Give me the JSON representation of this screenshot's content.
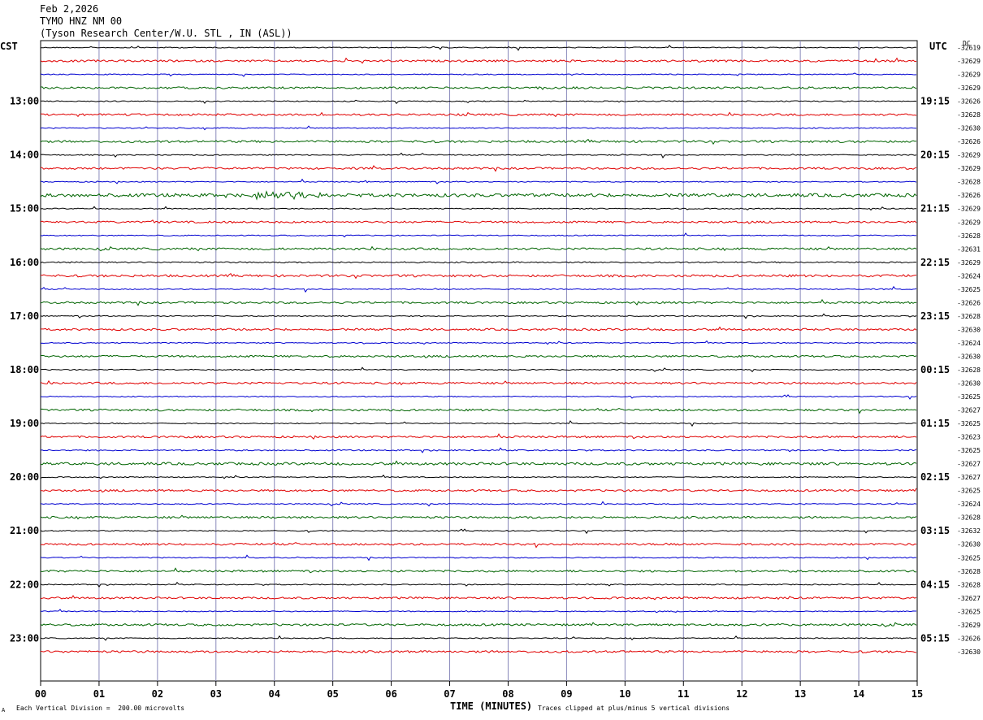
{
  "header": {
    "date": "Feb 2,2026",
    "station": "TYMO HNZ NM 00",
    "location": "(Tyson Research Center/W.U. STL , IN (ASL))"
  },
  "axes": {
    "left_tz": "CST",
    "right_tz": "UTC",
    "dc_label": "DC",
    "x_title": "TIME (MINUTES)"
  },
  "footer": {
    "scale_note": "Each Vertical Division =  200.00 microvolts",
    "clip_note": "Traces clipped at plus/minus 5 vertical divisions",
    "corner_mark": "A"
  },
  "colors": {
    "trace_cycle": [
      "#000000",
      "#e00000",
      "#0000d0",
      "#006400"
    ],
    "grid": "#8888bb"
  },
  "chart_data": {
    "type": "line",
    "title": "TYMO HNZ NM 00",
    "xlabel": "TIME (MINUTES)",
    "xlim": [
      0,
      15
    ],
    "x_ticks": [
      "00",
      "01",
      "02",
      "03",
      "04",
      "05",
      "06",
      "07",
      "08",
      "09",
      "10",
      "11",
      "12",
      "13",
      "14",
      "15"
    ],
    "trace_minutes": 15,
    "left_time_labels": [
      "13:00",
      "14:00",
      "15:00",
      "16:00",
      "17:00",
      "18:00",
      "19:00",
      "20:00",
      "21:00",
      "22:00",
      "23:00"
    ],
    "right_time_labels": [
      "19:15",
      "20:15",
      "21:15",
      "22:15",
      "23:15",
      "00:15",
      "01:15",
      "02:15",
      "03:15",
      "04:15",
      "05:15"
    ],
    "first_labeled_trace_index": 4,
    "traces_per_hour": 4,
    "dc_offsets": [
      -32619,
      -32629,
      -32629,
      -32629,
      -32626,
      -32628,
      -32630,
      -32626,
      -32629,
      -32629,
      -32628,
      -32626,
      -32629,
      -32629,
      -32628,
      -32631,
      -32629,
      -32624,
      -32625,
      -32626,
      -32628,
      -32630,
      -32624,
      -32630,
      -32628,
      -32630,
      -32625,
      -32627,
      -32625,
      -32623,
      -32625,
      -32627,
      -32627,
      -32625,
      -32624,
      -32628,
      -32632,
      -32630,
      -32625,
      -32628,
      -32628,
      -32627,
      -32625,
      -32629,
      -32626,
      -32630
    ],
    "noise_amplitude": [
      0.6,
      1.2,
      0.6,
      1.2,
      0.6,
      1.2,
      0.6,
      1.3,
      0.6,
      1.2,
      0.6,
      2.0,
      0.6,
      1.2,
      0.6,
      1.3,
      0.8,
      1.4,
      0.6,
      1.2,
      0.6,
      1.2,
      0.6,
      1.2,
      0.6,
      1.2,
      0.6,
      1.2,
      0.6,
      1.2,
      0.8,
      1.6,
      0.6,
      1.2,
      0.6,
      1.3,
      0.6,
      1.2,
      0.6,
      1.2,
      0.6,
      1.2,
      0.6,
      1.3,
      0.6,
      1.3
    ],
    "events": [
      {
        "trace": 11,
        "start_min": 3.6,
        "end_min": 4.8,
        "amplitude": 3
      }
    ]
  }
}
